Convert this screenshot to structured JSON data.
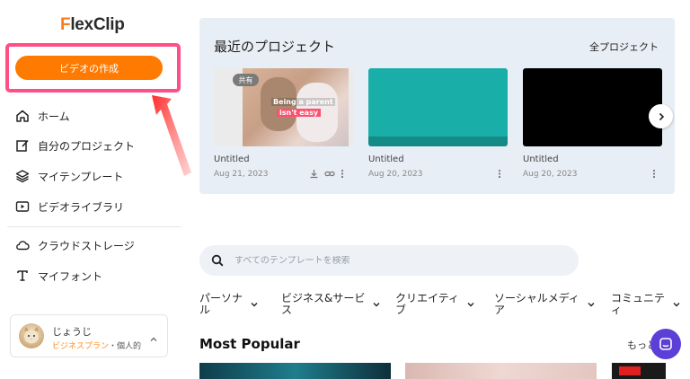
{
  "logo": {
    "first_letter": "F",
    "rest": "lexClip"
  },
  "create_button": {
    "label": "ビデオの作成"
  },
  "nav": [
    {
      "label": "ホーム",
      "icon": "home-icon"
    },
    {
      "label": "自分のプロジェクト",
      "icon": "edit-icon"
    },
    {
      "label": "マイテンプレート",
      "icon": "layers-icon"
    },
    {
      "label": "ビデオライブラリ",
      "icon": "video-library-icon"
    },
    {
      "label": "クラウドストレージ",
      "icon": "cloud-icon"
    },
    {
      "label": "マイフォント",
      "icon": "font-icon"
    }
  ],
  "user": {
    "name": "じょうじ",
    "plan": "ビジネスプラン",
    "plan_sub": "・個人的"
  },
  "recent": {
    "title": "最近のプロジェクト",
    "all_link": "全プロジェクト",
    "cards": [
      {
        "title": "Untitled",
        "date": "Aug 21, 2023",
        "badge": "共有",
        "caption_line1": "Being a parent",
        "caption_line2": "isn't easy",
        "color": "#ebebeb"
      },
      {
        "title": "Untitled",
        "date": "Aug 20, 2023",
        "color": "#1aaea9"
      },
      {
        "title": "Untitled",
        "date": "Aug 20, 2023",
        "color": "#000000"
      }
    ]
  },
  "search": {
    "placeholder": "すべてのテンプレートを検索"
  },
  "categories": [
    {
      "line1": "パーソナ",
      "line2": "ル"
    },
    {
      "line1": "ビジネス&サービ",
      "line2": "ス"
    },
    {
      "line1": "クリエイティ",
      "line2": "ブ"
    },
    {
      "line1": "ソーシャルメディ",
      "line2": "ア"
    },
    {
      "line1": "コミュニテ",
      "line2": "ィ"
    }
  ],
  "section": {
    "title": "Most Popular",
    "more": "もっと"
  },
  "colors": {
    "accent": "#ff7a00",
    "highlight": "#ff4f86",
    "panel": "#e8eef5",
    "chat": "#5b3fd6"
  }
}
